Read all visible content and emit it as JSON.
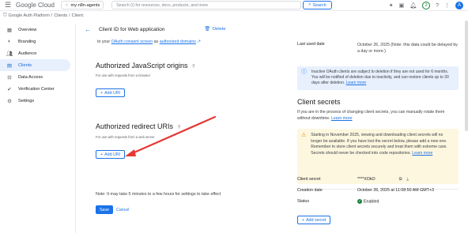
{
  "topbar": {
    "logo": "Google Cloud",
    "project": "my-n8n-agents",
    "search_placeholder": "Search (/) for resources, docs, products, and more",
    "search_button": "Search",
    "notification_count": "2",
    "avatar_initial": "A"
  },
  "breadcrumbs": {
    "root": "Google Auth Platform",
    "clients": "Clients",
    "current": "Client:"
  },
  "sidebar": {
    "items": [
      {
        "label": "Overview",
        "icon": "grid-icon"
      },
      {
        "label": "Branding",
        "icon": "palette-icon"
      },
      {
        "label": "Audience",
        "icon": "people-icon"
      },
      {
        "label": "Clients",
        "icon": "key-icon"
      },
      {
        "label": "Data Access",
        "icon": "lock-icon"
      },
      {
        "label": "Verification Center",
        "icon": "verified-icon"
      },
      {
        "label": "Settings",
        "icon": "gear-icon"
      }
    ]
  },
  "header": {
    "title": "Client ID for Web application",
    "delete_label": "Delete"
  },
  "main": {
    "consent_prefix": "to your",
    "consent_link": "OAuth consent screen",
    "consent_middle": "as",
    "consent_link2": "authorized domains",
    "js_origins_title": "Authorized JavaScript origins",
    "js_origins_sub": "For use with requests from a browser",
    "add_uri_label": "Add URI",
    "redirect_title": "Authorized redirect URIs",
    "redirect_sub": "For use with requests from a web server",
    "note": "Note: It may take 5 minutes to a few hours for settings to take effect",
    "save_label": "Save",
    "cancel_label": "Cancel"
  },
  "right": {
    "last_used_key": "Last used date",
    "last_used_val": "October 26, 2025 (Note: this data could be delayed by a day or more.)",
    "inactive_info": "Inactive OAuth clients are subject to deletion if they are not used for 6 months. You will be notified of deletion due to inactivity, and can restore clients up to 30 days after deletion.",
    "learn_more": "Learn more",
    "secrets_title": "Client secrets",
    "secrets_desc": "If you are in the process of changing client secrets, you can manually rotate them without downtime.",
    "warning": "Starting in November 2025, viewing and downloading client secrets will no longer be available. If you have lost the secret below, please add a new one. Remember to store client secrets securely and treat them with extreme care. Secrets should never be checked into code repositories.",
    "client_secret_key": "Client secret",
    "client_secret_val": "****XOkO",
    "creation_key": "Creation date",
    "creation_val": "October 26, 2025 at 11:08:50 AM GMT+3",
    "status_key": "Status",
    "status_val": "Enabled",
    "add_secret_label": "Add secret"
  },
  "colors": {
    "accent": "#1a73e8",
    "annotation_arrow": "#e53935",
    "info_bg": "#e8f0fe",
    "warn_bg": "#fef7e0",
    "status_enabled": "#188038"
  }
}
